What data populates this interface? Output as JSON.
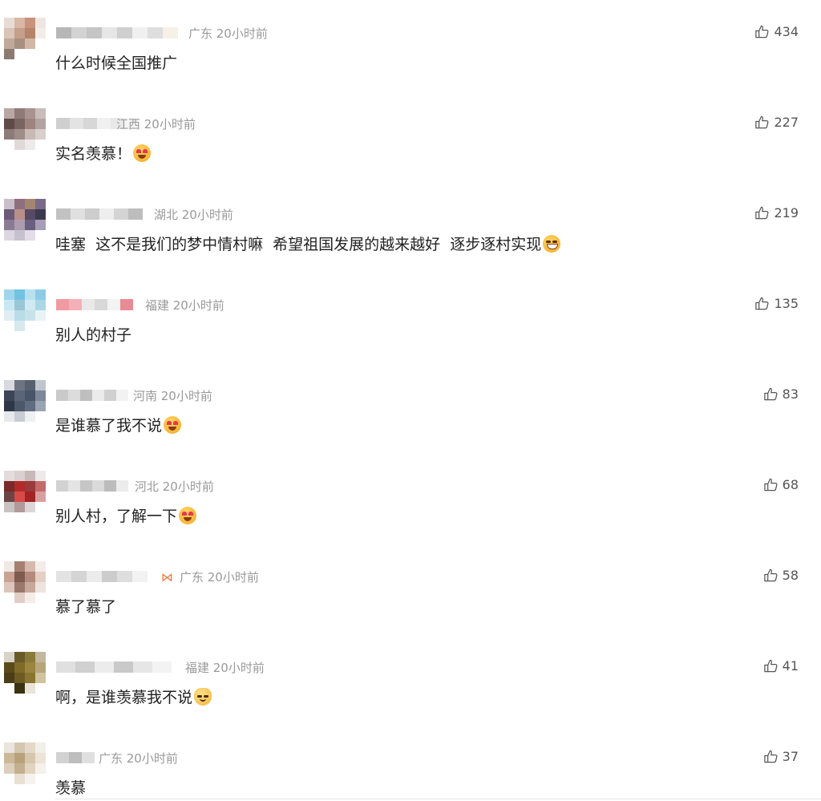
{
  "comments": [
    {
      "region": "广东 20小时前",
      "text": "什么时候全国推广",
      "likes": "434",
      "emoji": ""
    },
    {
      "region": "江西 20小时前",
      "text": "实名羡慕！",
      "likes": "227",
      "emoji": "star-struck-emoji"
    },
    {
      "region": "湖北 20小时前",
      "text": "哇塞  这不是我们的梦中情村嘛  希望祖国发展的越来越好  逐步逐村实现",
      "likes": "219",
      "emoji": "grin-emoji"
    },
    {
      "region": "福建 20小时前",
      "text": "别人的村子",
      "likes": "135",
      "emoji": ""
    },
    {
      "region": "河南 20小时前",
      "text": "是谁慕了我不说",
      "likes": "83",
      "emoji": "star-struck-emoji"
    },
    {
      "region": "河北 20小时前",
      "text": "别人村，了解一下",
      "likes": "68",
      "emoji": "star-struck-emoji"
    },
    {
      "region": "广东 20小时前",
      "text": "慕了慕了",
      "likes": "58",
      "emoji": ""
    },
    {
      "region": "福建 20小时前",
      "text": "啊，是谁羡慕我不说",
      "likes": "41",
      "emoji": "smirk-cat-emoji"
    },
    {
      "region": "广东 20小时前",
      "text": "羡慕",
      "likes": "37",
      "emoji": ""
    }
  ],
  "icons": {
    "like": "thumbs-up-icon",
    "avatar": "pixelated-avatar"
  },
  "colors": {
    "meta": "#999999",
    "text": "#222222",
    "count": "#555555",
    "divider": "#e6e6e6"
  }
}
